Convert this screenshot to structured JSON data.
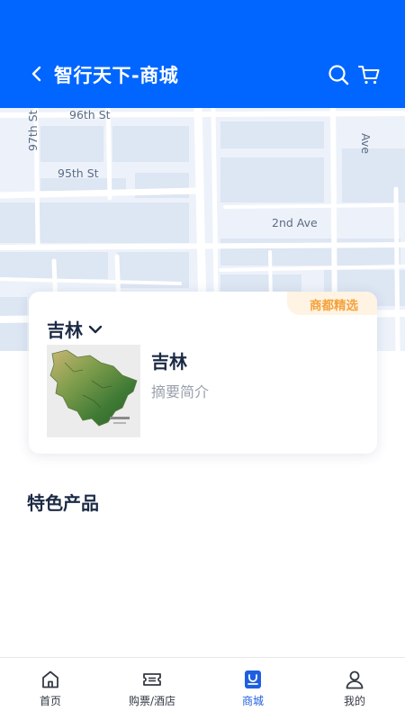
{
  "header": {
    "title": "智行天下-商城",
    "back_icon": "chevron-left-icon",
    "search_icon": "search-icon",
    "cart_icon": "cart-icon",
    "background": "#0066ff"
  },
  "map": {
    "street_labels": [
      "96th St",
      "97th St",
      "95th St",
      "2nd Ave",
      "Ave"
    ]
  },
  "card": {
    "badge": "商都精选",
    "region": "吉林",
    "region_dropdown_icon": "chevron-down-icon",
    "product": {
      "name": "吉林",
      "summary": "摘要简介",
      "image": "jilin-map-thumbnail"
    }
  },
  "section": {
    "featured_title": "特色产品"
  },
  "tabbar": {
    "active_color": "#1e5fe0",
    "items": [
      {
        "label": "首页",
        "icon": "home-icon"
      },
      {
        "label": "购票/酒店",
        "icon": "ticket-icon"
      },
      {
        "label": "商城",
        "icon": "shop-bag-icon",
        "active": true
      },
      {
        "label": "我的",
        "icon": "user-icon"
      }
    ]
  }
}
